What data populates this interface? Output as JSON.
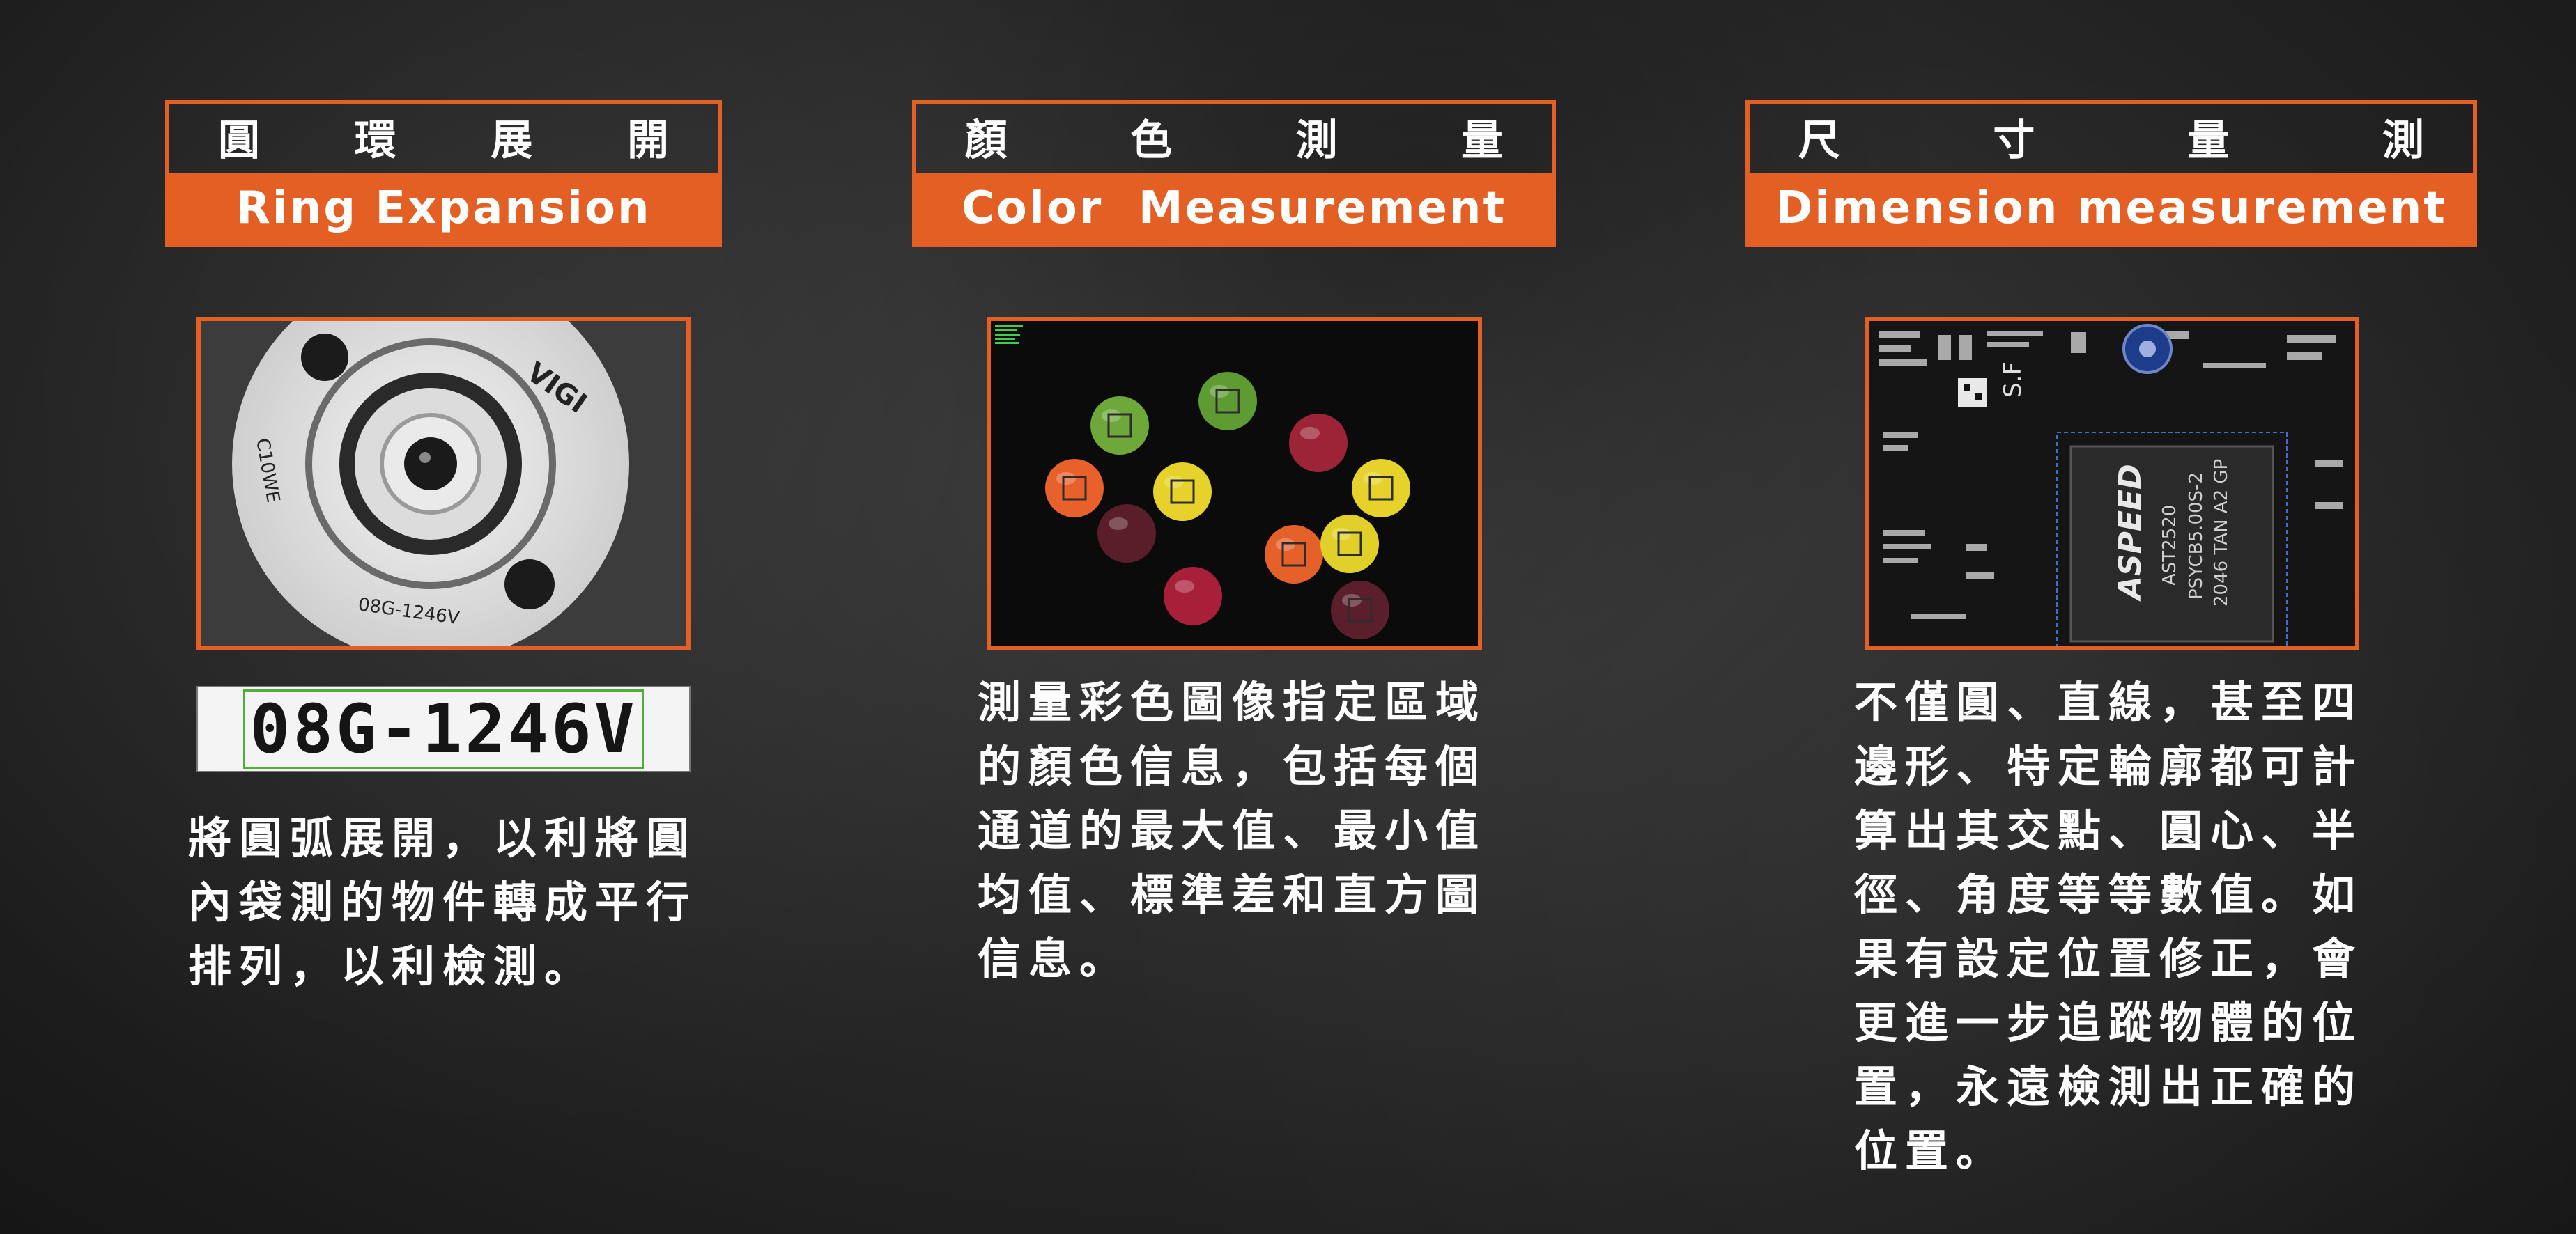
{
  "sections": [
    {
      "title_zh": [
        "圓",
        "環",
        "展",
        "開"
      ],
      "title_en": "Ring Expansion",
      "image": {
        "stamp_top": "VIGI",
        "stamp_side": "C10WE",
        "stamp_bottom": "08G-1246V",
        "ocr_text": "08G-1246V"
      },
      "desc": [
        "將圓弧展開，以利將圓",
        "內袋測的物件轉成平行",
        "排列，以利檢測。"
      ]
    },
    {
      "title_zh": [
        "顏",
        "色",
        "測",
        "量"
      ],
      "title_en": "Color  Measurement",
      "desc": [
        "測量彩色圖像指定區域",
        "的顏色信息，包括每個",
        "通道的最大值、最小值",
        "均值、標準差和直方圖",
        "信息。"
      ]
    },
    {
      "title_zh": [
        "尺",
        "寸",
        "量",
        "測"
      ],
      "title_en": "Dimension measurement",
      "image": {
        "chip_brand": "ASPEED",
        "chip_line1": "AST2520",
        "chip_line2": "PSYCB5.00S-2",
        "chip_line3": "2046 TAN A2 GP",
        "board_mark": "S.F"
      },
      "desc": [
        "不僅圓、直線，甚至四",
        "邊形、特定輪廓都可計",
        "算出其交點、圓心、半",
        "徑、角度等等數值。如",
        "果有設定位置修正，會",
        "更進一步追蹤物體的位",
        "置，永遠檢測出正確的",
        "位置。"
      ]
    }
  ],
  "candies": [
    {
      "color": "#6fa83a",
      "box": true
    },
    {
      "color": "#5e9c33",
      "box": true
    },
    {
      "color": "#9c2436",
      "box": false
    },
    {
      "color": "#e8602a",
      "box": true
    },
    {
      "color": "#e6d22a",
      "box": true
    },
    {
      "color": "#e6d22a",
      "box": true
    },
    {
      "color": "#5a1e2a",
      "box": false
    },
    {
      "color": "#e6602a",
      "box": true
    },
    {
      "color": "#e2d02a",
      "box": true
    },
    {
      "color": "#a81f3a",
      "box": false
    },
    {
      "color": "#5b1f2c",
      "box": true
    }
  ]
}
